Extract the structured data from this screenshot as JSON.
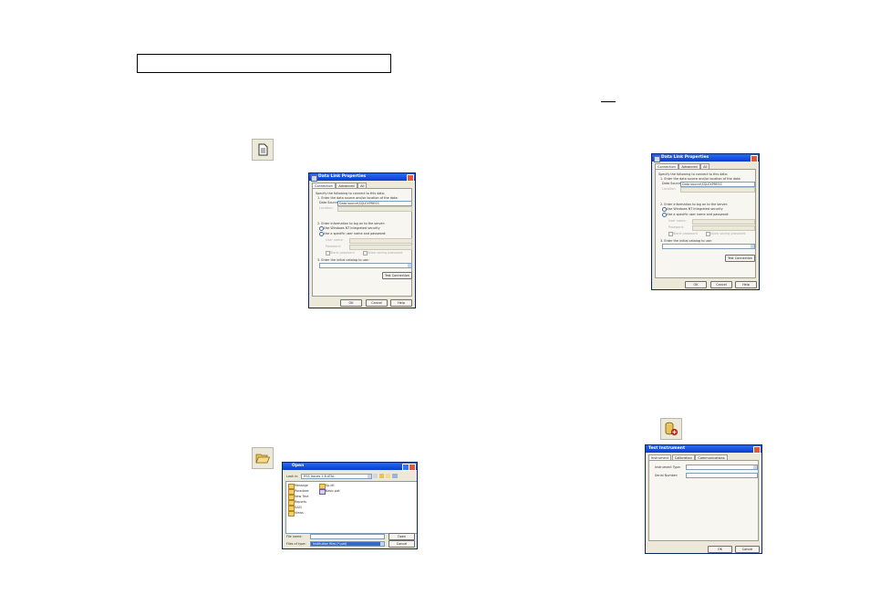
{
  "page": {
    "header_box_text": ""
  },
  "icons": {
    "new_doc": "document-icon",
    "open_folder": "open-folder-icon",
    "db_plus": "database-add-icon"
  },
  "datalink_dialog": {
    "title": "Data Link Properties",
    "tabs": [
      "Connection",
      "Advanced",
      "All"
    ],
    "intro": "Specify the following to connect to this data:",
    "step1": "1. Enter the data source and/or location of the data:",
    "data_source_label": "Data Source:",
    "data_source_value": "Data source\\SQLEXPRESS",
    "location_label": "Location:",
    "step2": "2. Enter information to log on to the server:",
    "opt_windows": "Use Windows NT Integrated security",
    "opt_specific": "Use a specific user name and password:",
    "user_label": "User name:",
    "password_label": "Password:",
    "blank_password": "Blank password",
    "allow_saving": "Allow saving password",
    "step3": "3. Enter the initial catalog to use:",
    "test_button": "Test Connection",
    "ok": "OK",
    "cancel": "Cancel",
    "help": "Help"
  },
  "open_dialog": {
    "title": "Open",
    "look_in_label": "Look in:",
    "look_in_value": "RSS Issues 1.8.ATAL",
    "folders": [
      "Message",
      "Paradoxe",
      "New Text",
      "Reports",
      "SASI",
      "Views"
    ],
    "files": [
      "Sp.dll",
      "Basic.pat"
    ],
    "filename_label": "File name:",
    "filetype_label": "Files of type:",
    "filetype_value": "Institution files (*.pat)",
    "open_btn": "Open",
    "cancel_btn": "Cancel"
  },
  "test_dialog": {
    "title": "Test Instrument",
    "tabs": [
      "Instrument",
      "Calibration",
      "Communications"
    ],
    "type_label": "Instrument Type:",
    "serial_label": "Serial Number:",
    "ok": "OK",
    "cancel": "Cancel"
  }
}
